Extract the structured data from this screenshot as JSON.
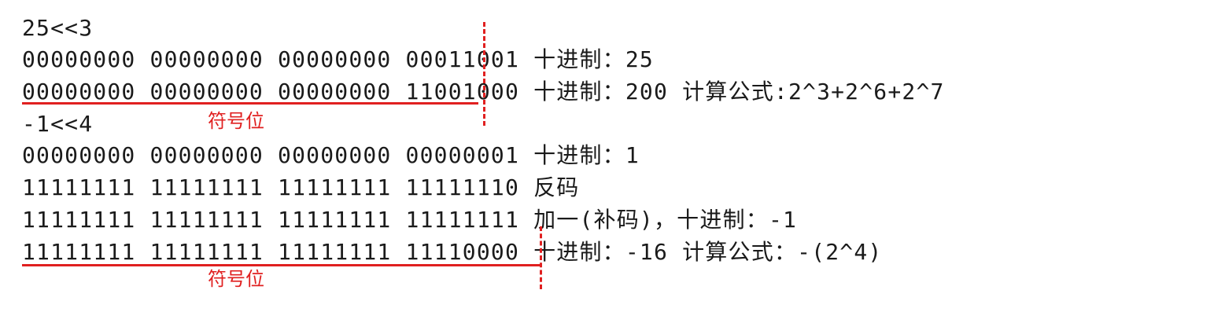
{
  "lines": [
    "25<<3",
    "00000000 00000000 00000000 00011001 十进制：25",
    "00000000 00000000 00000000 11001000 十进制：200 计算公式:2^3+2^6+2^7",
    "-1<<4",
    "00000000 00000000 00000000 00000001 十进制：1",
    "11111111 11111111 11111111 11111110 反码",
    "11111111 11111111 11111111 11111111 加一(补码)，十进制：-1",
    "11111111 11111111 11111111 11110000 十进制：-16 计算公式：-(2^4)"
  ],
  "annotations": {
    "sign_bit_1": "符号位",
    "sign_bit_2": "符号位"
  },
  "colors": {
    "text": "#1a1a1a",
    "annotation": "#e02020",
    "background": "#ffffff"
  }
}
